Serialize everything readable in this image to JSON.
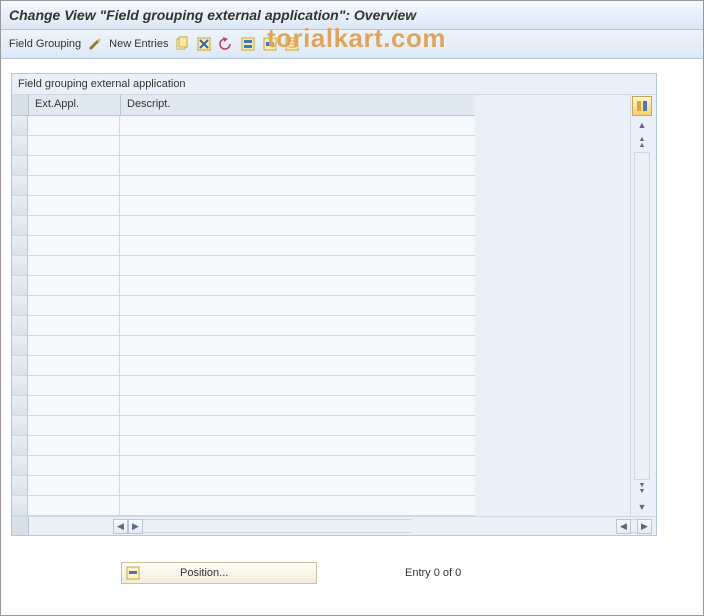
{
  "window": {
    "title": "Change View \"Field grouping external application\": Overview"
  },
  "toolbar": {
    "field_grouping_label": "Field Grouping",
    "new_entries_label": "New Entries"
  },
  "watermark": "torialkart.com",
  "groupbox": {
    "label": "Field grouping external application"
  },
  "grid": {
    "columns": {
      "ext_appl": "Ext.Appl.",
      "descript": "Descript."
    },
    "rows": [
      {
        "ext_appl": "",
        "descript": ""
      },
      {
        "ext_appl": "",
        "descript": ""
      },
      {
        "ext_appl": "",
        "descript": ""
      },
      {
        "ext_appl": "",
        "descript": ""
      },
      {
        "ext_appl": "",
        "descript": ""
      },
      {
        "ext_appl": "",
        "descript": ""
      },
      {
        "ext_appl": "",
        "descript": ""
      },
      {
        "ext_appl": "",
        "descript": ""
      },
      {
        "ext_appl": "",
        "descript": ""
      },
      {
        "ext_appl": "",
        "descript": ""
      },
      {
        "ext_appl": "",
        "descript": ""
      },
      {
        "ext_appl": "",
        "descript": ""
      },
      {
        "ext_appl": "",
        "descript": ""
      },
      {
        "ext_appl": "",
        "descript": ""
      },
      {
        "ext_appl": "",
        "descript": ""
      },
      {
        "ext_appl": "",
        "descript": ""
      },
      {
        "ext_appl": "",
        "descript": ""
      },
      {
        "ext_appl": "",
        "descript": ""
      },
      {
        "ext_appl": "",
        "descript": ""
      },
      {
        "ext_appl": "",
        "descript": ""
      },
      {
        "ext_appl": "",
        "descript": ""
      }
    ]
  },
  "footer": {
    "position_label": "Position...",
    "entry_status": "Entry 0 of 0"
  }
}
